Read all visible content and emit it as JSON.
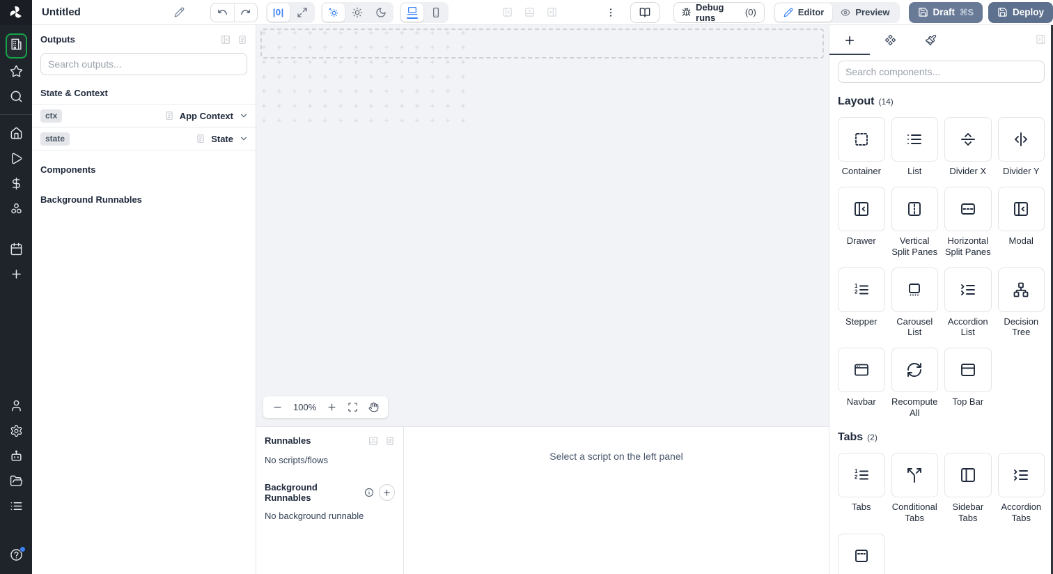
{
  "topbar": {
    "title": "Untitled",
    "zoom_reset_label": "|0|",
    "debug_runs_label": "Debug runs",
    "debug_runs_count": "(0)",
    "editor_label": "Editor",
    "preview_label": "Preview",
    "draft_label": "Draft",
    "draft_shortcut": "⌘S",
    "deploy_label": "Deploy"
  },
  "sidebar": {
    "top_items": [
      {
        "name": "app-builder",
        "icon": "building",
        "active": true
      },
      {
        "name": "favorites",
        "icon": "star"
      },
      {
        "name": "search",
        "icon": "search"
      }
    ],
    "middle_items": [
      {
        "name": "home",
        "icon": "home"
      },
      {
        "name": "runs",
        "icon": "play"
      },
      {
        "name": "variables",
        "icon": "dollar"
      },
      {
        "name": "resources",
        "icon": "cluster"
      },
      {
        "name": "schedules",
        "icon": "calendar",
        "gap_before": true
      },
      {
        "name": "create",
        "icon": "plus"
      }
    ],
    "bottom_items": [
      {
        "name": "account",
        "icon": "user"
      },
      {
        "name": "settings",
        "icon": "gear"
      },
      {
        "name": "workers",
        "icon": "bot"
      },
      {
        "name": "folders",
        "icon": "folder"
      },
      {
        "name": "logs",
        "icon": "logs"
      },
      {
        "name": "help",
        "icon": "help",
        "badge": true,
        "help_gap": true
      }
    ]
  },
  "outputs_panel": {
    "title": "Outputs",
    "search_placeholder": "Search outputs...",
    "state_context_header": "State & Context",
    "components_header": "Components",
    "background_runnables_header": "Background Runnables",
    "rows": [
      {
        "badge": "ctx",
        "type": "App Context"
      },
      {
        "badge": "state",
        "type": "State"
      }
    ]
  },
  "canvas": {
    "zoom_level": "100%"
  },
  "runnables_panel": {
    "title": "Runnables",
    "empty_scripts": "No scripts/flows",
    "background_title": "Background Runnables",
    "empty_background": "No background runnable",
    "select_hint": "Select a script on the left panel"
  },
  "components_panel": {
    "search_placeholder": "Search components...",
    "sections": [
      {
        "title": "Layout",
        "count": "(14)",
        "items": [
          {
            "label": "Container",
            "icon": "container"
          },
          {
            "label": "List",
            "icon": "list"
          },
          {
            "label": "Divider X",
            "icon": "dividerx"
          },
          {
            "label": "Divider Y",
            "icon": "dividery"
          },
          {
            "label": "Drawer",
            "icon": "drawer"
          },
          {
            "label": "Vertical Split Panes",
            "icon": "vsplit"
          },
          {
            "label": "Horizontal Split Panes",
            "icon": "hsplit"
          },
          {
            "label": "Modal",
            "icon": "drawer"
          },
          {
            "label": "Stepper",
            "icon": "stepper"
          },
          {
            "label": "Carousel List",
            "icon": "carousel"
          },
          {
            "label": "Accordion List",
            "icon": "accordionlist"
          },
          {
            "label": "Decision Tree",
            "icon": "decisiontree"
          },
          {
            "label": "Navbar",
            "icon": "navbar"
          },
          {
            "label": "Recompute All",
            "icon": "recompute"
          },
          {
            "label": "Top Bar",
            "icon": "topbarpanel"
          }
        ]
      },
      {
        "title": "Tabs",
        "count": "(2)",
        "items": [
          {
            "label": "Tabs",
            "icon": "stepper"
          },
          {
            "label": "Conditional Tabs",
            "icon": "condtabs"
          },
          {
            "label": "Sidebar Tabs",
            "icon": "sidebartabs"
          },
          {
            "label": "Accordion Tabs",
            "icon": "accordionlist"
          },
          {
            "label": "",
            "icon": "invisibletabs"
          }
        ]
      }
    ]
  },
  "colors": {
    "accent_blue": "#3b82f6",
    "sidebar_bg": "#1f242b",
    "active_green": "#16a34a",
    "draft_button": "#697a97",
    "deploy_button": "#5d708e"
  }
}
